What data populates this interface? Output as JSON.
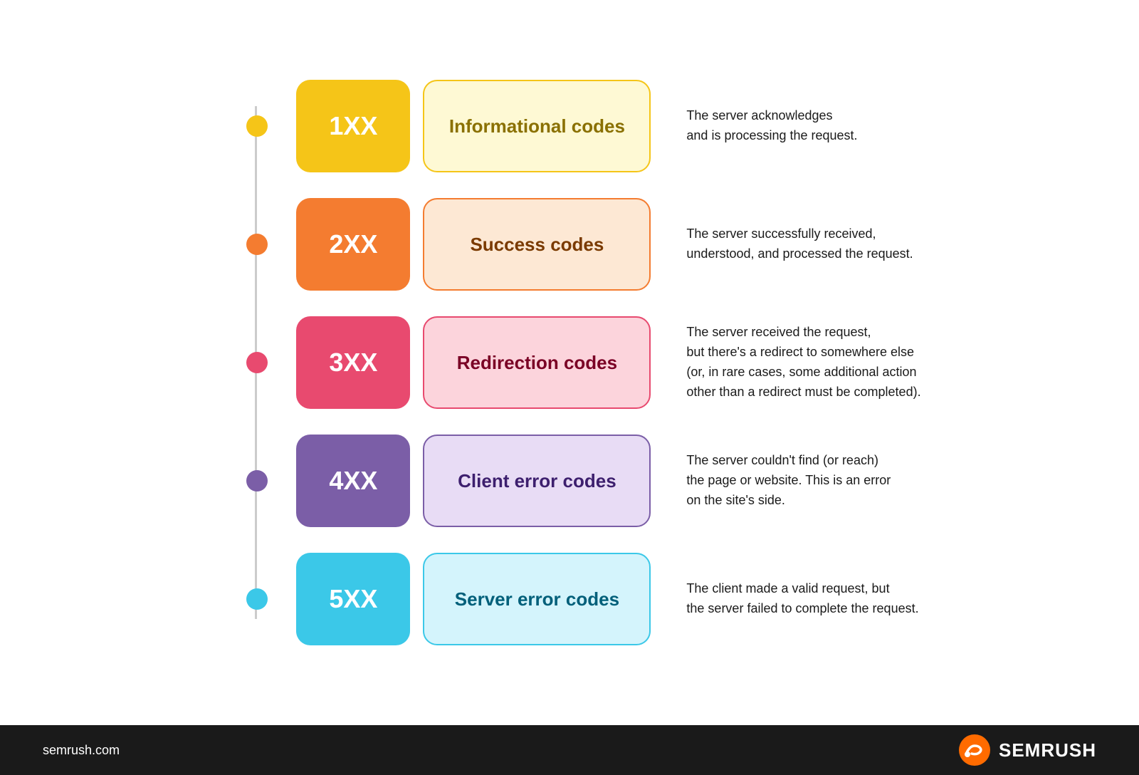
{
  "rows": [
    {
      "id": 1,
      "code": "1XX",
      "label": "Informational codes",
      "description": "The server acknowledges\nand is processing the request.",
      "dotClass": "dot-1",
      "codeClass": "code-1",
      "labelClass": "label-1"
    },
    {
      "id": 2,
      "code": "2XX",
      "label": "Success codes",
      "description": "The server successfully received,\nunderstood, and processed the request.",
      "dotClass": "dot-2",
      "codeClass": "code-2",
      "labelClass": "label-2"
    },
    {
      "id": 3,
      "code": "3XX",
      "label": "Redirection codes",
      "description": "The server received the request,\nbut there's a redirect to somewhere else\n(or, in rare cases, some additional action\nother than a redirect must be completed).",
      "dotClass": "dot-3",
      "codeClass": "code-3",
      "labelClass": "label-3"
    },
    {
      "id": 4,
      "code": "4XX",
      "label": "Client error codes",
      "description": "The server couldn't find (or reach)\nthe page or website. This is an error\non the site's side.",
      "dotClass": "dot-4",
      "codeClass": "code-4",
      "labelClass": "label-4"
    },
    {
      "id": 5,
      "code": "5XX",
      "label": "Server error codes",
      "description": "The client made a valid request, but\nthe server failed to complete the request.",
      "dotClass": "dot-5",
      "codeClass": "code-5",
      "labelClass": "label-5"
    }
  ],
  "footer": {
    "url": "semrush.com",
    "brand": "SEMRUSH"
  }
}
